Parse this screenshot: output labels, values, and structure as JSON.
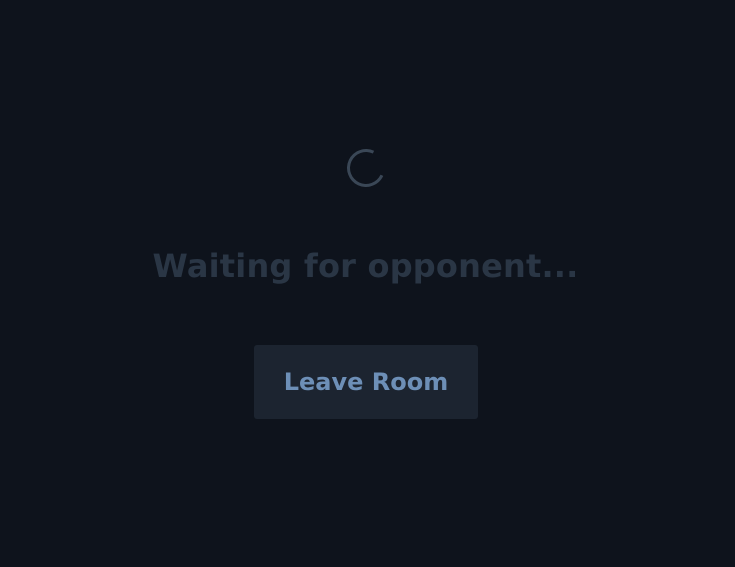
{
  "status": {
    "message": "Waiting for opponent..."
  },
  "actions": {
    "leave_label": "Leave Room"
  },
  "icons": {
    "spinner": "loading-spinner-icon"
  },
  "colors": {
    "background": "#0e131c",
    "spinner": "#3a4756",
    "status_text": "#2a3645",
    "button_background": "#1c2430",
    "button_text": "#6d8fb7"
  }
}
